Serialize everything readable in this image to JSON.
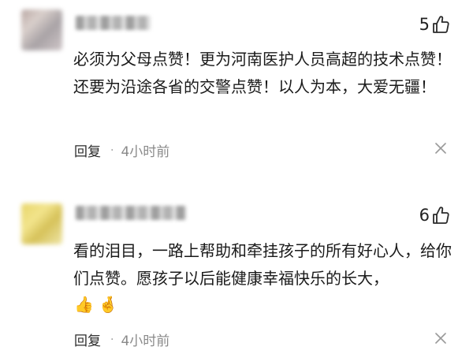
{
  "comments": [
    {
      "likes": "5",
      "text": "必须为父母点赞！更为河南医护人员高超的技术点赞！还要为沿途各省的交警点赞！以人为本，大爱无疆！",
      "reply_label": "回复",
      "separator": "·",
      "time": "4小时前",
      "avatar_icon": "blurred-avatar",
      "like_icon": "thumbs-up-outline-icon",
      "dismiss_icon": "close-x-icon"
    },
    {
      "likes": "6",
      "text": "看的泪目，一路上帮助和牵挂孩子的所有好心人，给你们点赞。愿孩子以后能健康幸福快乐的长大，",
      "emojis": [
        "👍",
        "🤞"
      ],
      "reply_label": "回复",
      "separator": "·",
      "time": "4小时前",
      "avatar_icon": "blurred-avatar",
      "like_icon": "thumbs-up-outline-icon",
      "dismiss_icon": "close-x-icon"
    }
  ],
  "colors": {
    "text": "#1a1a1a",
    "meta": "#8a8a8a",
    "background": "#ffffff"
  }
}
